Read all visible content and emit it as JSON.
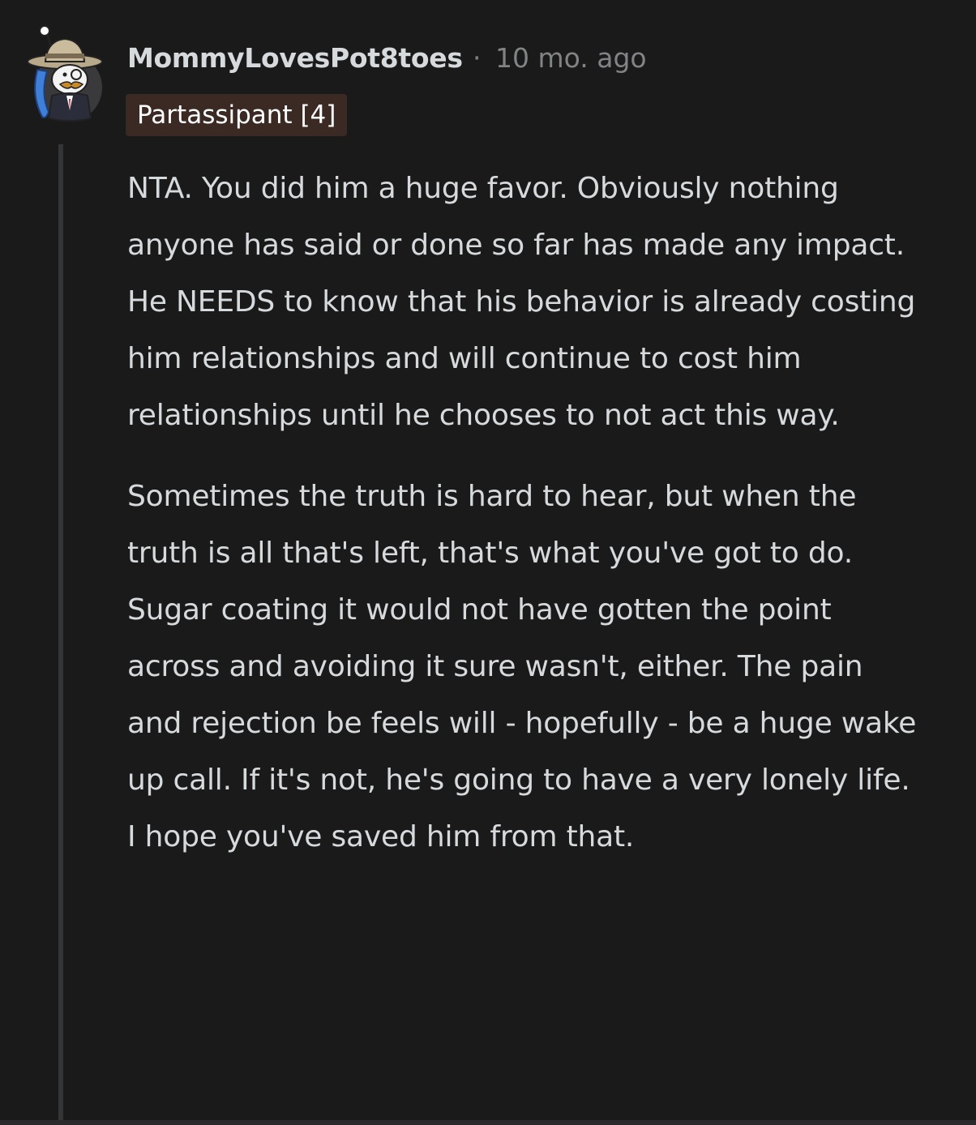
{
  "comment": {
    "author": "MommyLovesPot8toes",
    "separator": "·",
    "timestamp": "10 mo. ago",
    "flair": "Partassipant [4]",
    "avatar_icon": "snoo-avatar-icon",
    "paragraphs": [
      "NTA. You did him a huge favor. Obviously nothing anyone has said or done so far has made any impact. He NEEDS to know that his behavior is already costing him relationships and will continue to cost him relationships until he chooses to not act this way.",
      "Sometimes the truth is hard to hear, but when the truth is all that's left, that's what you've got to do. Sugar coating it would not have gotten the point across and avoiding it sure wasn't, either. The pain and rejection be feels will - hopefully - be a huge wake up call. If it's not, he's going to have a very lonely life. I hope you've saved him from that."
    ]
  },
  "colors": {
    "background": "#1a1a1b",
    "text": "#d7dadc",
    "muted": "#818384",
    "flair_bg": "#3b2a24",
    "thread_line": "#343536"
  }
}
